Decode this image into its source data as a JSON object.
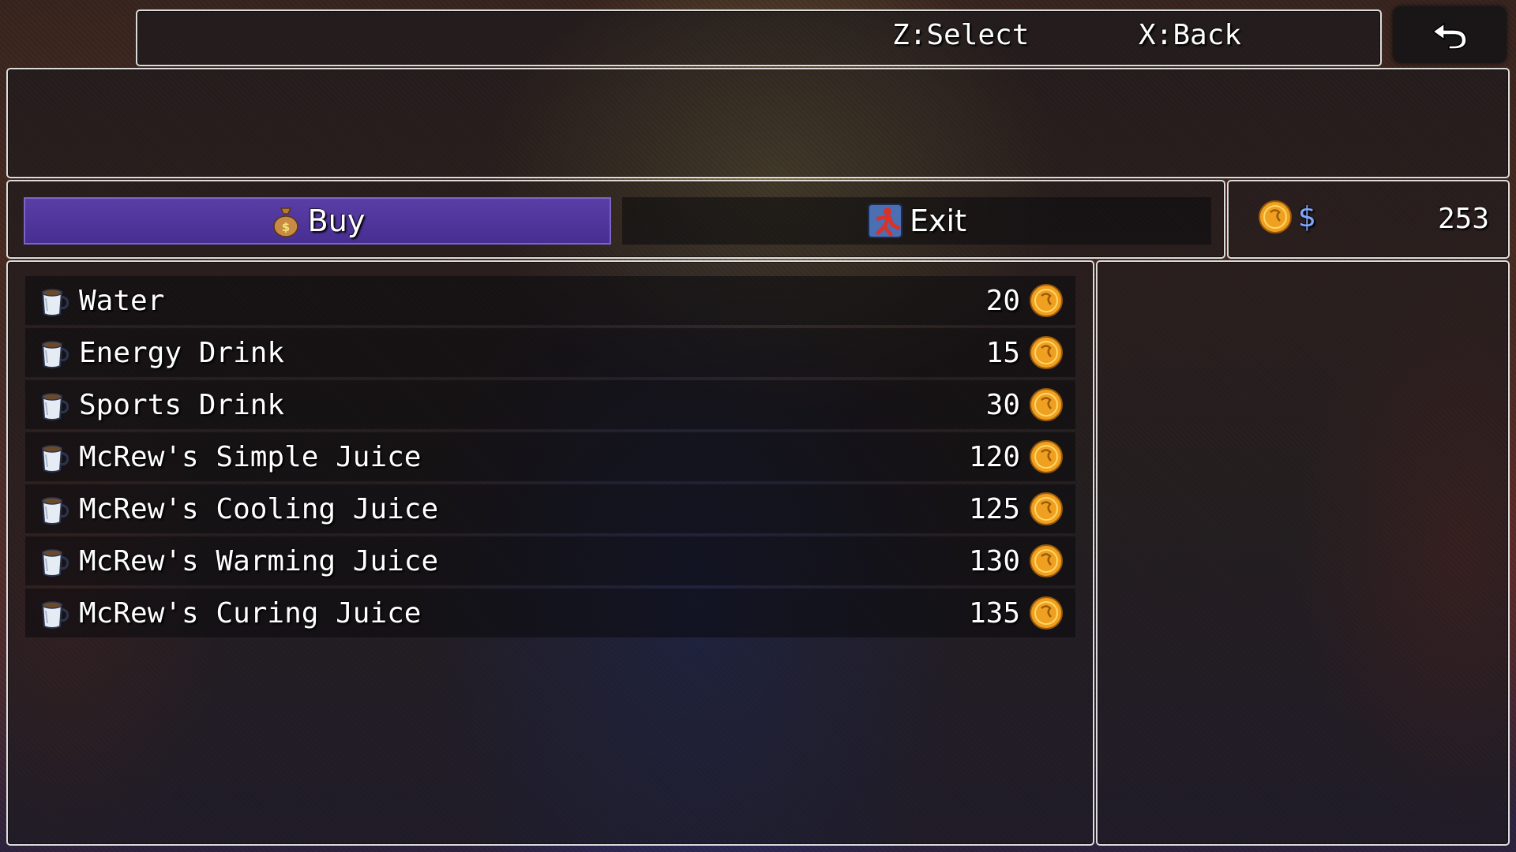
{
  "help": {
    "select": "Z:Select",
    "back": "X:Back"
  },
  "back_button": {
    "icon": "return-arrow-icon"
  },
  "commands": [
    {
      "label": "Buy",
      "icon": "money-bag-icon",
      "selected": true
    },
    {
      "label": "Exit",
      "icon": "running-exit-icon",
      "selected": false
    }
  ],
  "gold": {
    "icon": "coin-icon",
    "currency": "$",
    "amount": "253"
  },
  "items": [
    {
      "name": "Water",
      "price": "20",
      "icon": "cup-icon"
    },
    {
      "name": "Energy Drink",
      "price": "15",
      "icon": "cup-icon"
    },
    {
      "name": "Sports Drink",
      "price": "30",
      "icon": "cup-icon"
    },
    {
      "name": "McRew's Simple Juice",
      "price": "120",
      "icon": "cup-icon"
    },
    {
      "name": "McRew's Cooling Juice",
      "price": "125",
      "icon": "cup-icon"
    },
    {
      "name": "McRew's Warming Juice",
      "price": "130",
      "icon": "cup-icon"
    },
    {
      "name": "McRew's Curing Juice",
      "price": "135",
      "icon": "cup-icon"
    }
  ],
  "colors": {
    "selection": "#5a3ea6",
    "currency_symbol": "#7fa8ff",
    "coin": "#f0a020"
  }
}
